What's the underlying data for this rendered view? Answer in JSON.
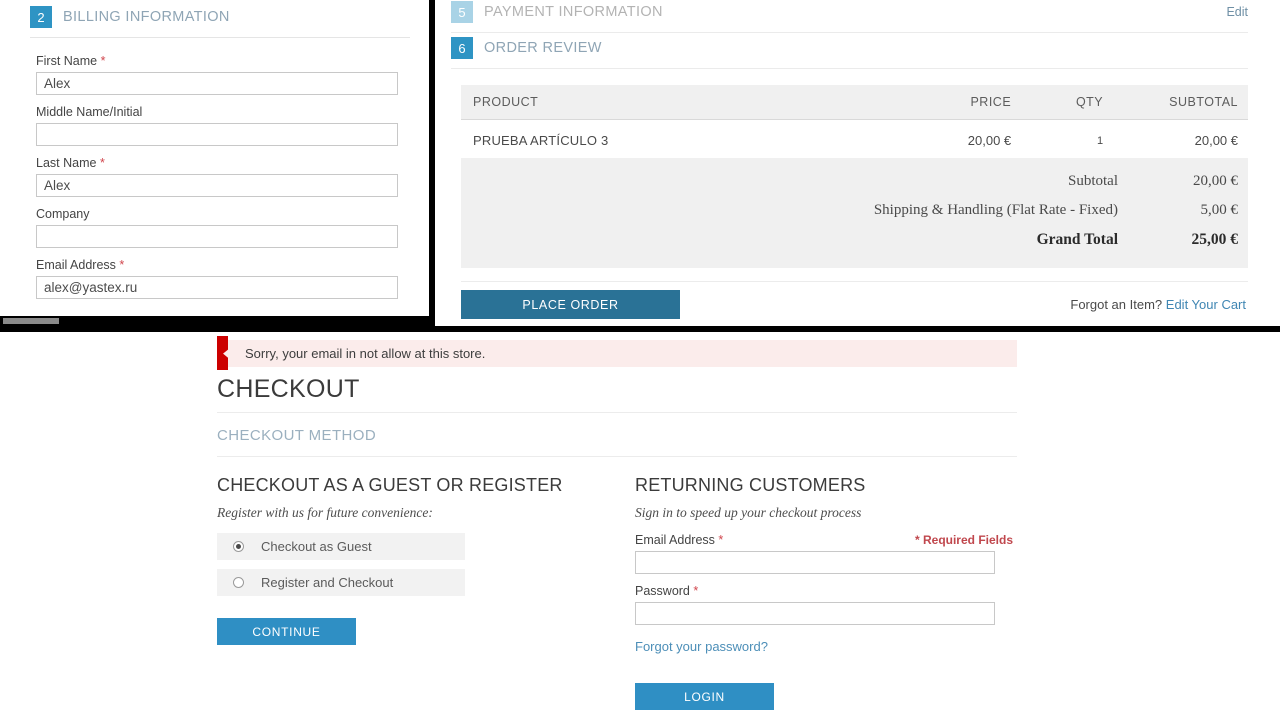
{
  "colors": {
    "accent_blue": "#2e94c4",
    "accent_blue_light": "#a9d3e6",
    "place_order_blue": "#2a7296",
    "button_blue": "#2f8fc4",
    "link_blue": "#3f86b3",
    "required_red": "#d0454c",
    "error_flag_red": "#cc0000",
    "error_bg": "#fbeceb",
    "section_title_gray": "#8fa5b5"
  },
  "billing": {
    "step_number": "2",
    "section_title": "BILLING INFORMATION",
    "fields": [
      {
        "label": "First Name",
        "required": true,
        "value": "Alex",
        "placeholder": ""
      },
      {
        "label": "Middle Name/Initial",
        "required": false,
        "value": "",
        "placeholder": ""
      },
      {
        "label": "Last Name",
        "required": true,
        "value": "Alex",
        "placeholder": ""
      },
      {
        "label": "Company",
        "required": false,
        "value": "",
        "placeholder": ""
      },
      {
        "label": "Email Address",
        "required": true,
        "value": "alex@yastex.ru",
        "placeholder": ""
      }
    ]
  },
  "payment_section": {
    "step_number": "5",
    "title": "PAYMENT INFORMATION",
    "edit_label": "Edit"
  },
  "order_review": {
    "step_number": "6",
    "title": "ORDER REVIEW",
    "columns": [
      "PRODUCT",
      "PRICE",
      "QTY",
      "SUBTOTAL"
    ],
    "items": [
      {
        "product": "PRUEBA ARTÍCULO 3",
        "price": "20,00 €",
        "qty": "1",
        "subtotal": "20,00 €"
      }
    ],
    "totals": [
      {
        "label": "Subtotal",
        "value": "20,00 €"
      },
      {
        "label": "Shipping & Handling (Flat Rate - Fixed)",
        "value": "5,00 €"
      },
      {
        "label": "Grand Total",
        "value": "25,00 €"
      }
    ],
    "place_order_label": "PLACE ORDER",
    "forgot_item_text": "Forgot an Item?",
    "edit_cart_label": "Edit Your Cart"
  },
  "checkout_page": {
    "error_message": "Sorry, your email in not allow at this store.",
    "page_title": "CHECKOUT",
    "method_heading": "CHECKOUT METHOD",
    "guest": {
      "title": "CHECKOUT AS A GUEST OR REGISTER",
      "subtitle": "Register with us for future convenience:",
      "options": [
        {
          "label": "Checkout as Guest",
          "selected": true
        },
        {
          "label": "Register and Checkout",
          "selected": false
        }
      ],
      "continue_label": "CONTINUE"
    },
    "returning": {
      "title": "RETURNING CUSTOMERS",
      "subtitle": "Sign in to speed up your checkout process",
      "required_note": "* Required Fields",
      "email_label": "Email Address",
      "email_value": "",
      "email_placeholder": "",
      "password_label": "Password",
      "password_value": "",
      "password_placeholder": "",
      "forgot_password_label": "Forgot your password?",
      "login_label": "LOGIN"
    }
  }
}
